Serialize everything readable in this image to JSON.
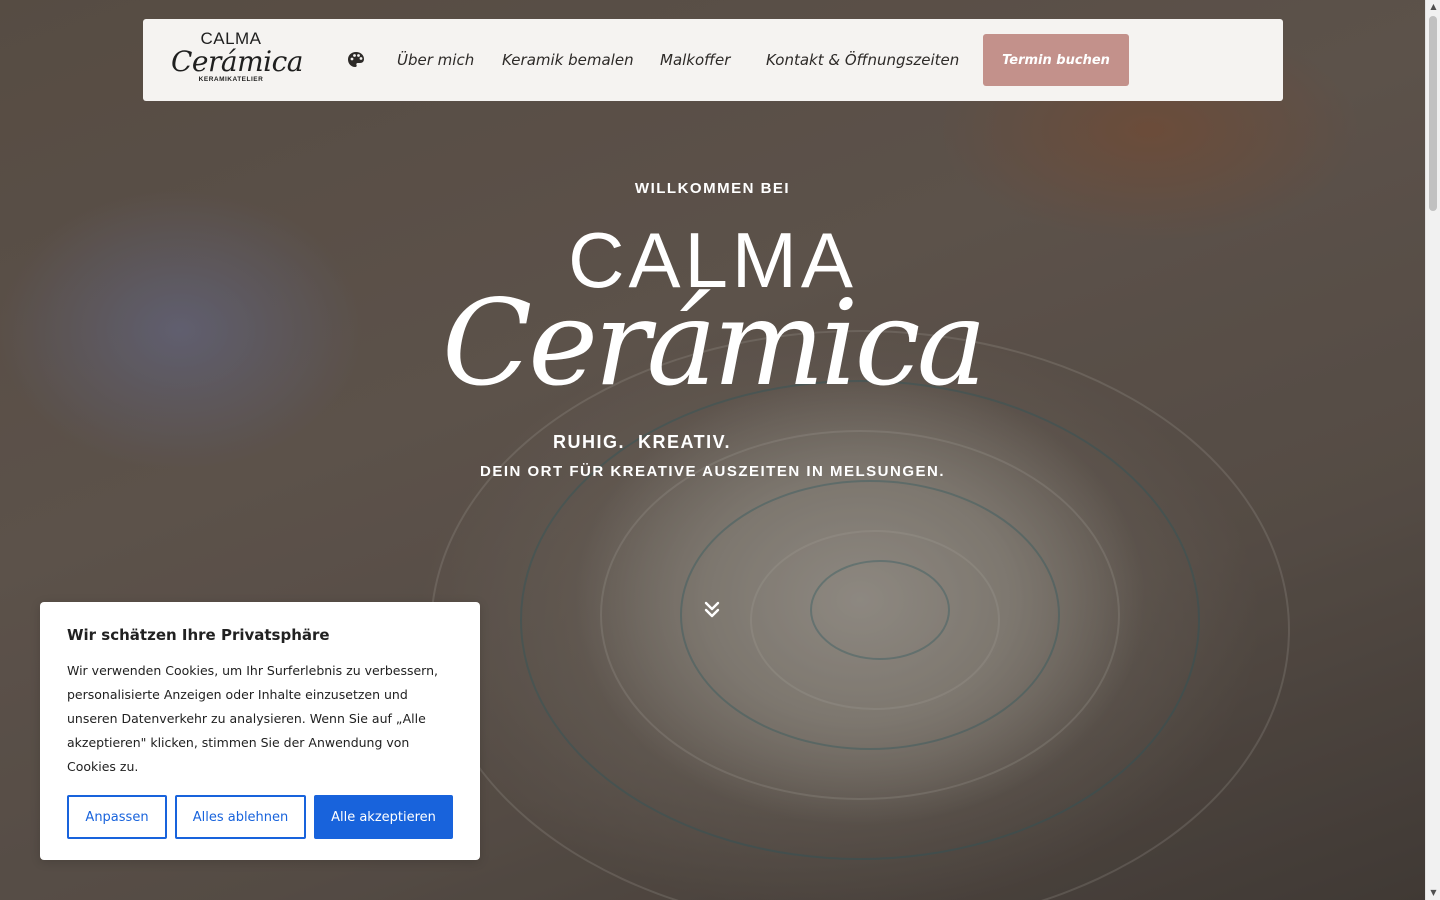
{
  "header": {
    "logo": {
      "line1": "CALMA",
      "line2": "Cerámica",
      "line3": "KERAMIKATELIER"
    },
    "palette_icon": "palette-icon",
    "nav": [
      {
        "label": "Über mich"
      },
      {
        "label": "Keramik bemalen"
      },
      {
        "label": "Malkoffer"
      },
      {
        "label": "Kontakt & Öffnungszeiten"
      }
    ],
    "cta_label": "Termin buchen"
  },
  "hero": {
    "welcome": "WILLKOMMEN BEI",
    "title_top": "CALMA",
    "title_script": "Cerámica",
    "tagline": "RUHIG.  KREATIV.",
    "subline": "DEIN ORT FÜR KREATIVE AUSZEITEN IN MELSUNGEN.",
    "scroll_icon": "double-chevron-down-icon"
  },
  "cookie_banner": {
    "title": "Wir schätzen Ihre Privatsphäre",
    "text": "Wir verwenden Cookies, um Ihr Surferlebnis zu verbessern, personalisierte Anzeigen oder Inhalte einzusetzen und unseren Datenverkehr zu analysieren. Wenn Sie auf „Alle akzeptieren\" klicken, stimmen Sie der Anwendung von Cookies zu.",
    "btn_customize": "Anpassen",
    "btn_reject": "Alles ablehnen",
    "btn_accept": "Alle akzeptieren"
  },
  "colors": {
    "header_bg": "#f5f3f1",
    "cta_bg": "#c3918b",
    "cookie_accent": "#1863dc"
  }
}
